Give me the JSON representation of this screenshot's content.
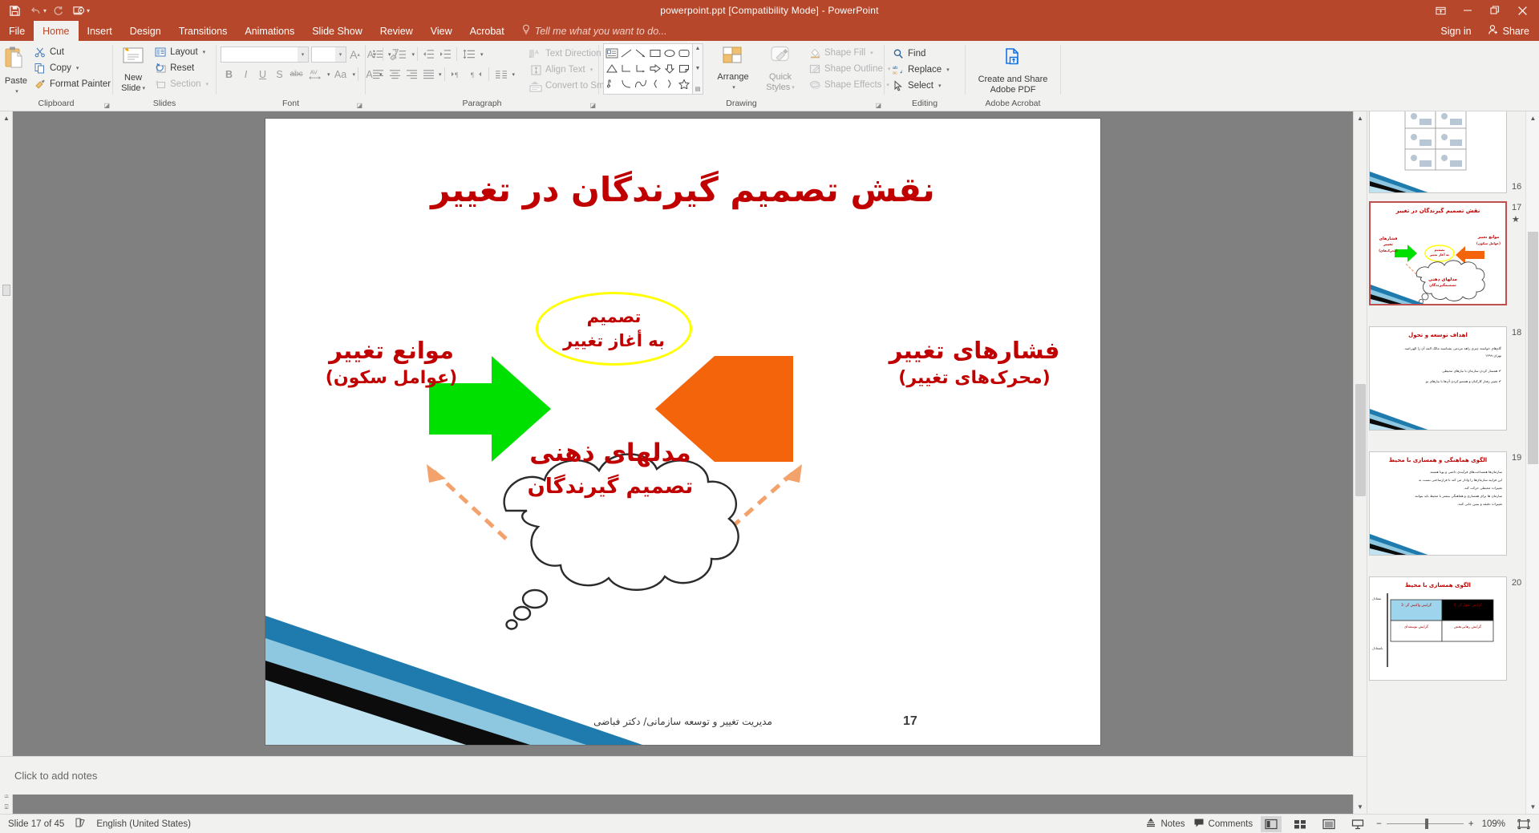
{
  "window": {
    "title": "powerpoint.ppt [Compatibility Mode] - PowerPoint",
    "accent_color": "#b7472a",
    "quick_access": [
      {
        "name": "save",
        "glyph": "💾"
      },
      {
        "name": "undo",
        "glyph": "↶"
      },
      {
        "name": "redo",
        "glyph": "↻"
      },
      {
        "name": "start-slideshow",
        "glyph": "▷"
      }
    ],
    "controls": {
      "ribbon_display_options": "▣",
      "minimize": "—",
      "restore": "❐",
      "close": "✕"
    }
  },
  "tabs": [
    {
      "label": "File",
      "active": false
    },
    {
      "label": "Home",
      "active": true
    },
    {
      "label": "Insert",
      "active": false
    },
    {
      "label": "Design",
      "active": false
    },
    {
      "label": "Transitions",
      "active": false
    },
    {
      "label": "Animations",
      "active": false
    },
    {
      "label": "Slide Show",
      "active": false
    },
    {
      "label": "Review",
      "active": false
    },
    {
      "label": "View",
      "active": false
    },
    {
      "label": "Acrobat",
      "active": false
    }
  ],
  "tellme": {
    "placeholder": "Tell me what you want to do..."
  },
  "account": {
    "signin": "Sign in",
    "share": "Share"
  },
  "ribbon": {
    "groups": [
      {
        "label": "Clipboard",
        "has_dialog_launcher": true
      },
      {
        "label": "Slides",
        "has_dialog_launcher": false
      },
      {
        "label": "Font",
        "has_dialog_launcher": true
      },
      {
        "label": "Paragraph",
        "has_dialog_launcher": true
      },
      {
        "label": "Drawing",
        "has_dialog_launcher": true
      },
      {
        "label": "Editing",
        "has_dialog_launcher": false
      },
      {
        "label": "Adobe Acrobat",
        "has_dialog_launcher": false
      }
    ],
    "clipboard": {
      "paste": "Paste",
      "cut": "Cut",
      "copy": "Copy",
      "format_painter": "Format Painter"
    },
    "slides": {
      "new_slide_line1": "New",
      "new_slide_line2": "Slide",
      "layout": "Layout",
      "reset": "Reset",
      "section": "Section"
    },
    "font": {
      "font_name_value": "",
      "font_size_value": "",
      "buttons": [
        "B",
        "I",
        "U",
        "S",
        "abc",
        "AV",
        "Aa",
        "A"
      ],
      "grow_font": "A",
      "shrink_font": "A",
      "clear_formatting": "clear-formatting-icon"
    },
    "paragraph": {
      "text_direction": "Text Direction",
      "align_text": "Align Text",
      "convert_to_smartart": "Convert to SmartArt"
    },
    "drawing": {
      "arrange": "Arrange",
      "quick_styles_line1": "Quick",
      "quick_styles_line2": "Styles",
      "shape_fill": "Shape Fill",
      "shape_outline": "Shape Outline",
      "shape_effects": "Shape Effects"
    },
    "editing": {
      "find": "Find",
      "replace": "Replace",
      "select": "Select"
    },
    "acrobat": {
      "line1": "Create and Share",
      "line2": "Adobe PDF"
    }
  },
  "slide": {
    "title": "نقش تصمیم گیرندگان در تغییر",
    "left_label_line1": "فشارهای  تغییر",
    "left_label_line2": "(محرک‌های تغییر)",
    "right_label_line1": "موانع  تغییر",
    "right_label_line2": "(عوامل سکون)",
    "center_line1": "تصمیم",
    "center_line2": "به أغاز تغییر",
    "cloud_line1": "مدلهای ذهنی",
    "cloud_line2": "تصمیم گیرندگان",
    "footer": "مدیریت تغییر و توسعه سازمانی/ دکتر فباضی",
    "number": "17",
    "colors": {
      "title_red": "#C00000",
      "green_arrow": "#00E000",
      "orange_arrow": "#F4640A",
      "ellipse_outline": "#FFFF00",
      "dashed_arrow": "#F4A26B"
    }
  },
  "thumbnails": [
    {
      "number": "16",
      "selected": false,
      "title": "",
      "starred": false
    },
    {
      "number": "17",
      "selected": true,
      "starred": true,
      "title": "نقش تصمیم گیرندگان در تغییر",
      "labels": {
        "left": "فشارهای تغییر",
        "left_sub": "(محرک‌های)",
        "right": "موانع تغییر",
        "right_sub": "(عوامل سکون)",
        "center": "تصمیم",
        "center_sub": "به آغاز تغییر",
        "cloud": "مدلهای ذهنی",
        "cloud_sub": "تصمیمگیرندگان"
      }
    },
    {
      "number": "18",
      "selected": false,
      "starred": false,
      "title": "اهداف توسعه و تحول",
      "lines": [
        "گام‌های خواسته چیزی راهه مردمی بشناسید مالک المه آن را الهی‌امید.",
        "تهران ۱۳۹۹",
        "همساز کردن سازمان با نیازهای محیطی",
        "تغییر رفتار کارکنان و همسو کردن آن‌ها با نیازهای نو"
      ]
    },
    {
      "number": "19",
      "selected": false,
      "starred": false,
      "title": "الگوی هماهنگی و همسازی با محیط",
      "lines": [
        "سازمان‌ها همساخت‌های فرآیندی دائمی و پویا هستند",
        "این فرایند سازمان‌ها را وادار می کند تا فرارساختی نسبت به",
        "تغییرات محیطی حرکت کند.",
        "سازمان ها برای همسازی و هماهنگی بیشتر با محیط باید بتوانند",
        "تغییرات دقیقه و بینین جایی کنند."
      ]
    },
    {
      "number": "20",
      "selected": false,
      "starred": false,
      "title": "الگوی همسازی با محیط",
      "table": {
        "axis_top": "متعادل",
        "axis_bottom": "نامتعادل",
        "cells": [
          "گرایش واکنش گر:\n3",
          "گرایش تحول گر:\n4",
          "گرایش توسعه‌ای",
          "گرایش رهایی‌بخش"
        ]
      }
    }
  ],
  "notes": {
    "placeholder": "Click to add notes"
  },
  "status": {
    "slide_counter": "Slide 17 of 45",
    "language": "English (United States)",
    "notes_label": "Notes",
    "comments_label": "Comments",
    "zoom_level": "109%",
    "views": [
      "normal-view",
      "slide-sorter-view",
      "reading-view",
      "slide-show-view"
    ],
    "zoom_out": "−",
    "zoom_in": "+"
  }
}
